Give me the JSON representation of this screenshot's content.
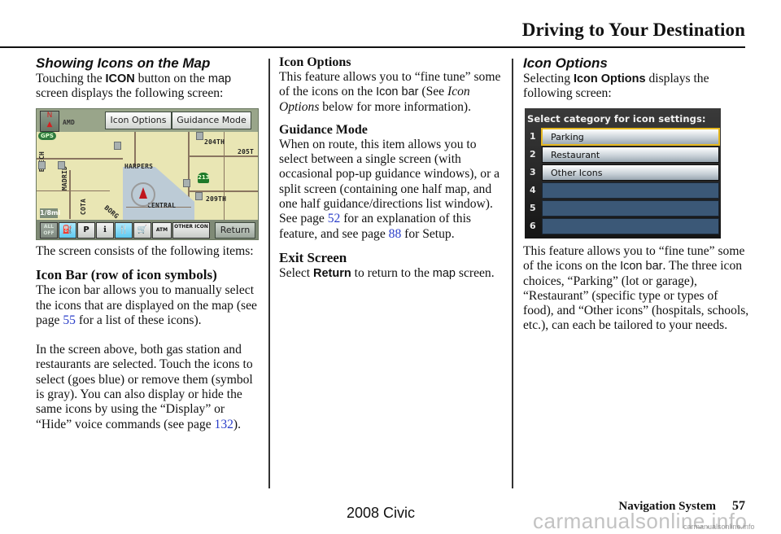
{
  "header": {
    "title": "Driving to Your Destination"
  },
  "left_column": {
    "heading": "Showing Icons on the Map",
    "intro": {
      "pre": "Touching the ",
      "icon_word": "ICON",
      "mid": " button on the ",
      "map_word": "map",
      "post": " screen displays the following screen:"
    },
    "map_screen": {
      "buttons": {
        "icon_options": "Icon Options",
        "guidance_mode": "Guidance Mode",
        "return": "Return",
        "north": "N"
      },
      "labels": {
        "gps": "GPS",
        "amd": "AMD",
        "beech": "BEECH",
        "madrid": "MADRID",
        "harper": "HARPERS",
        "central": "CENTRAL",
        "st204": "204TH",
        "st205": "205T",
        "st209": "209TH",
        "hwy": "213",
        "scale": "1/8mi",
        "borg": "BORG",
        "cota": "COTA"
      },
      "icon_bar": [
        {
          "name": "all-off",
          "label": "ALL OFF",
          "selected": false
        },
        {
          "name": "gas-station",
          "label": "⛽",
          "selected": true
        },
        {
          "name": "parking",
          "label": "P",
          "selected": false
        },
        {
          "name": "information",
          "label": "ℹ",
          "selected": false
        },
        {
          "name": "restaurant",
          "label": "🍴",
          "selected": true
        },
        {
          "name": "shopping",
          "label": "🛒",
          "selected": false
        },
        {
          "name": "atm",
          "label": "ATM",
          "selected": false
        },
        {
          "name": "other-icon",
          "label": "OTHER ICON",
          "selected": false
        }
      ]
    },
    "consists": "The screen consists of the following items:",
    "icon_bar_heading": "Icon Bar (row of icon symbols)",
    "icon_bar_text": {
      "pre": "The icon bar allows you to manually select the icons that are displayed on the map (see page ",
      "page": "55",
      "post": " for a list of these icons)."
    },
    "selected_text": {
      "pre": "In the screen above, both gas station and restaurants are selected. Touch the icons to select (goes blue) or remove them (symbol is gray). You can also display or hide the same icons by using the “Display” or “Hide” voice commands (see page ",
      "page": "132",
      "post": ")."
    }
  },
  "middle_column": {
    "icon_options_heading": "Icon Options",
    "icon_options_text": {
      "pre": "This feature allows you to “fine tune” some of the icons on the ",
      "sans": "Icon bar",
      "mid": " (See ",
      "italic": "Icon Options",
      "post": " below for more information)."
    },
    "guidance_heading": "Guidance Mode",
    "guidance_text": {
      "pre": "When on route, this item allows you to select between a single screen (with occasional pop-up guidance windows), or a split screen (containing one half map, and one half guidance/directions list window). See page ",
      "page1": "52",
      "mid": " for an explanation of this feature, and see page ",
      "page2": "88",
      "post": " for Setup."
    },
    "exit_heading": "Exit Screen",
    "exit_text": {
      "pre": "Select ",
      "return_word": "Return",
      "mid": " to return to the ",
      "map_word": "map",
      "post": " screen."
    }
  },
  "right_column": {
    "heading": "Icon Options",
    "intro": {
      "pre": "Selecting ",
      "bold": "Icon Options",
      "post": " displays the following screen:"
    },
    "options_screen": {
      "title": "Select category for icon settings:",
      "rows": [
        {
          "num": "1",
          "label": "Parking",
          "focused": true
        },
        {
          "num": "2",
          "label": "Restaurant",
          "focused": false
        },
        {
          "num": "3",
          "label": "Other Icons",
          "focused": false
        },
        {
          "num": "4",
          "label": "",
          "focused": false
        },
        {
          "num": "5",
          "label": "",
          "focused": false
        },
        {
          "num": "6",
          "label": "",
          "focused": false
        }
      ]
    },
    "desc": {
      "pre": "This feature allows you to “fine tune” some of the icons on the ",
      "sans": "Icon bar",
      "post": ". The three icon choices, “Parking” (lot or garage), “Restaurant” (specific type or types of food), and “Other icons” (hospitals, schools, etc.), can each be tailored to your needs."
    }
  },
  "footer": {
    "section": "Navigation System",
    "page": "57",
    "model": "2008  Civic",
    "watermark": "carmanualsonline.info",
    "watermark_small": "carmanualsonline.info"
  }
}
